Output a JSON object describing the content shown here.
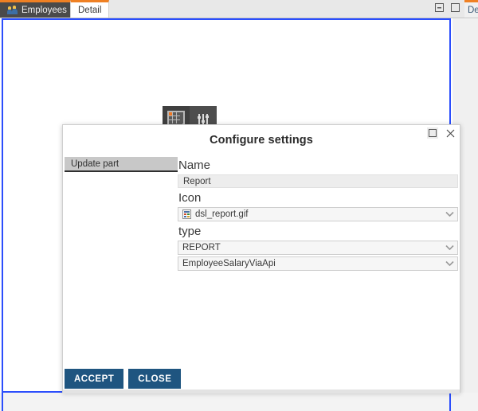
{
  "tabstrip": {
    "tabs": [
      {
        "label": "Employees",
        "icon": "users-icon",
        "state": "inactive-dark"
      },
      {
        "label": "Detail",
        "icon": "",
        "state": "active"
      },
      {
        "label": "De",
        "icon": "",
        "state": "clipped"
      }
    ],
    "window_buttons": [
      {
        "name": "minimize-icon",
        "glyph": "minimize"
      },
      {
        "name": "maximize-icon",
        "glyph": "maximize"
      }
    ]
  },
  "canvas": {
    "widget_toolbar": {
      "buttons": [
        {
          "name": "report-grid-icon",
          "selected": true
        },
        {
          "name": "sliders-settings-icon",
          "selected": false
        }
      ]
    }
  },
  "dialog": {
    "title": "Configure settings",
    "window_buttons": [
      {
        "name": "maximize-icon",
        "glyph": "maximize"
      },
      {
        "name": "close-icon",
        "glyph": "close"
      }
    ],
    "sidebar": {
      "items": [
        {
          "label": "Update part",
          "selected": true
        }
      ]
    },
    "form": {
      "fields": [
        {
          "label": "Name",
          "control": "text",
          "value": "Report"
        },
        {
          "label": "Icon",
          "control": "select-with-icon",
          "value": "dsl_report.gif",
          "icon": "report-file-icon"
        },
        {
          "label": "type",
          "control": "select",
          "value": "REPORT"
        },
        {
          "label": "",
          "control": "select",
          "value": "EmployeeSalaryViaApi"
        }
      ]
    },
    "footer": {
      "accept_label": "ACCEPT",
      "close_label": "CLOSE"
    }
  },
  "colors": {
    "accent_orange": "#ef8023",
    "canvas_border_blue": "#2b4efc",
    "button_blue": "#1f5580",
    "tab_dark": "#4a4a4a",
    "toolbar_dark": "#4d4d4d"
  }
}
